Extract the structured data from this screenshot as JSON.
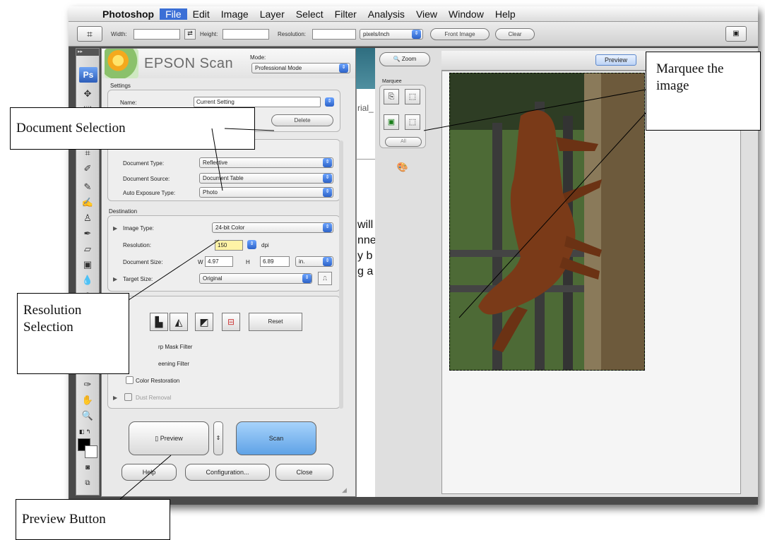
{
  "menubar": {
    "app": "Photoshop",
    "items": [
      "File",
      "Edit",
      "Image",
      "Layer",
      "Select",
      "Filter",
      "Analysis",
      "View",
      "Window",
      "Help"
    ],
    "active": "File"
  },
  "options": {
    "width_label": "Width:",
    "height_label": "Height:",
    "resolution_label": "Resolution:",
    "units": "pixels/inch",
    "front_image": "Front Image",
    "clear": "Clear"
  },
  "toolbar": {
    "badge": "Ps"
  },
  "epson": {
    "title": "EPSON Scan",
    "mode_label": "Mode:",
    "mode": "Professional Mode",
    "settings_label": "Settings",
    "name_label": "Name:",
    "name_value": "Current Setting",
    "delete": "Delete",
    "document_type_label": "Document Type:",
    "document_type": "Reflective",
    "document_source_label": "Document Source:",
    "document_source": "Document Table",
    "auto_exposure_label": "Auto Exposure Type:",
    "auto_exposure": "Photo",
    "destination_label": "Destination",
    "image_type_label": "Image Type:",
    "image_type": "24-bit Color",
    "resolution_label": "Resolution:",
    "resolution": "150",
    "dpi": "dpi",
    "document_size_label": "Document Size:",
    "w_label": "W",
    "w_value": "4.97",
    "h_label": "H",
    "h_value": "6.89",
    "size_unit": "in.",
    "target_size_label": "Target Size:",
    "target_size": "Original",
    "reset": "Reset",
    "unsharp": "rp Mask Filter",
    "descreening": "eening Filter",
    "color_restoration": "Color Restoration",
    "dust_removal": "Dust Removal",
    "preview": "Preview",
    "scan": "Scan",
    "help": "Help",
    "configuration": "Configuration...",
    "close": "Close"
  },
  "bg_doc": {
    "partial1": "rial_",
    "text_lines": [
      "will",
      "nne",
      "y b",
      "g a p"
    ]
  },
  "preview_window": {
    "zoom": "Zoom",
    "marquee_label": "Marquee",
    "all": "All",
    "preview_tab": "Preview"
  },
  "callouts": {
    "document_selection": "Document Selection",
    "resolution_selection": "Resolution Selection",
    "marquee": "Marquee the image",
    "preview_button": "Preview Button"
  },
  "colors": {
    "accent_blue": "#3b6fd6",
    "resolution_highlight": "#fff3a6",
    "scan_button": "#7fb8f2"
  }
}
